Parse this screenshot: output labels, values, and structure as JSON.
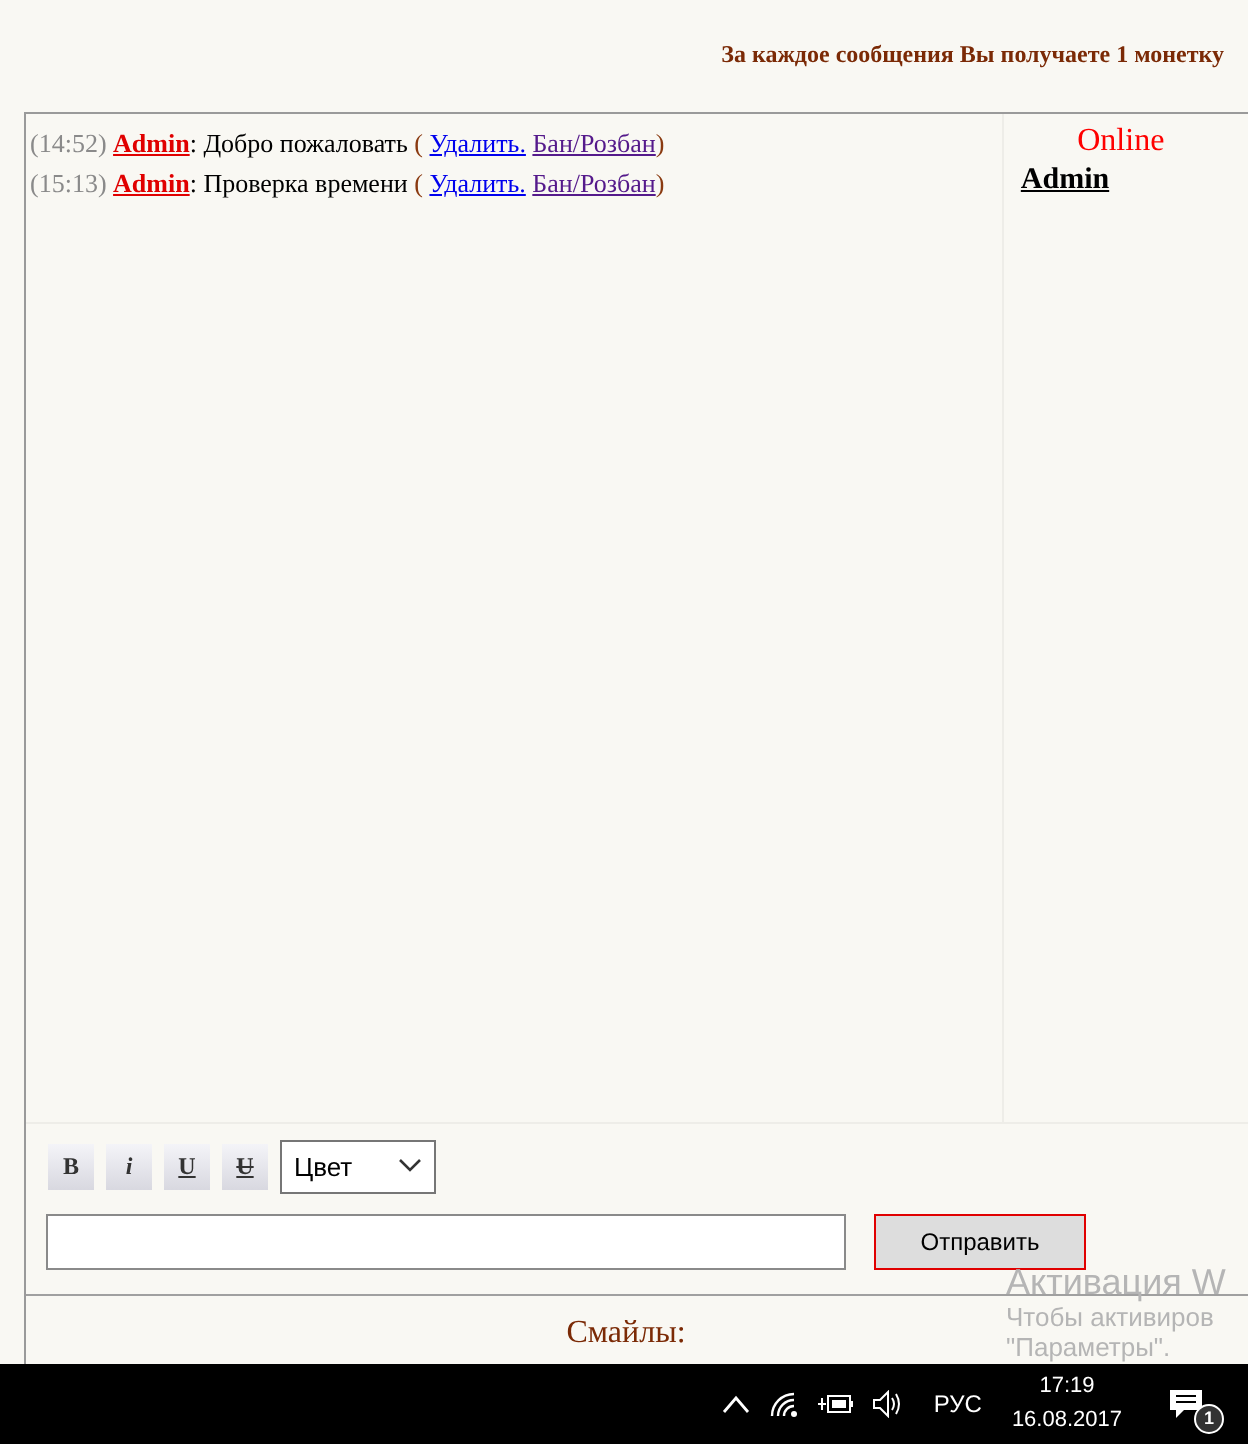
{
  "notice": "За каждое сообщения Вы получаете 1 монетку",
  "messages": [
    {
      "time": "(14:52)",
      "author": "Admin",
      "text": ": Добро пожаловать",
      "open_paren": "(",
      "actions": [
        "Удалить.",
        "Бан/Розбан"
      ],
      "close_paren": ")"
    },
    {
      "time": "(15:13)",
      "author": "Admin",
      "text": ": Проверка времени",
      "open_paren": "(",
      "actions": [
        "Удалить.",
        "Бан/Розбан"
      ],
      "close_paren": ")"
    }
  ],
  "online": {
    "title": "Online",
    "users": [
      "Admin"
    ]
  },
  "format_buttons": [
    {
      "kind": "bold",
      "label": "B"
    },
    {
      "kind": "italic",
      "label": "i"
    },
    {
      "kind": "underline",
      "label": "U"
    },
    {
      "kind": "strike",
      "label": "U"
    }
  ],
  "color_select": {
    "value": "Цвет"
  },
  "send_button": "Отправить",
  "smileys_title": "Смайлы:",
  "activation_notice": [
    "Активация W",
    "Чтобы активиров",
    "\"Параметры\"."
  ],
  "taskbar": {
    "language": "РУС",
    "time": "17:19",
    "date": "16.08.2017",
    "notification_count": "1"
  }
}
